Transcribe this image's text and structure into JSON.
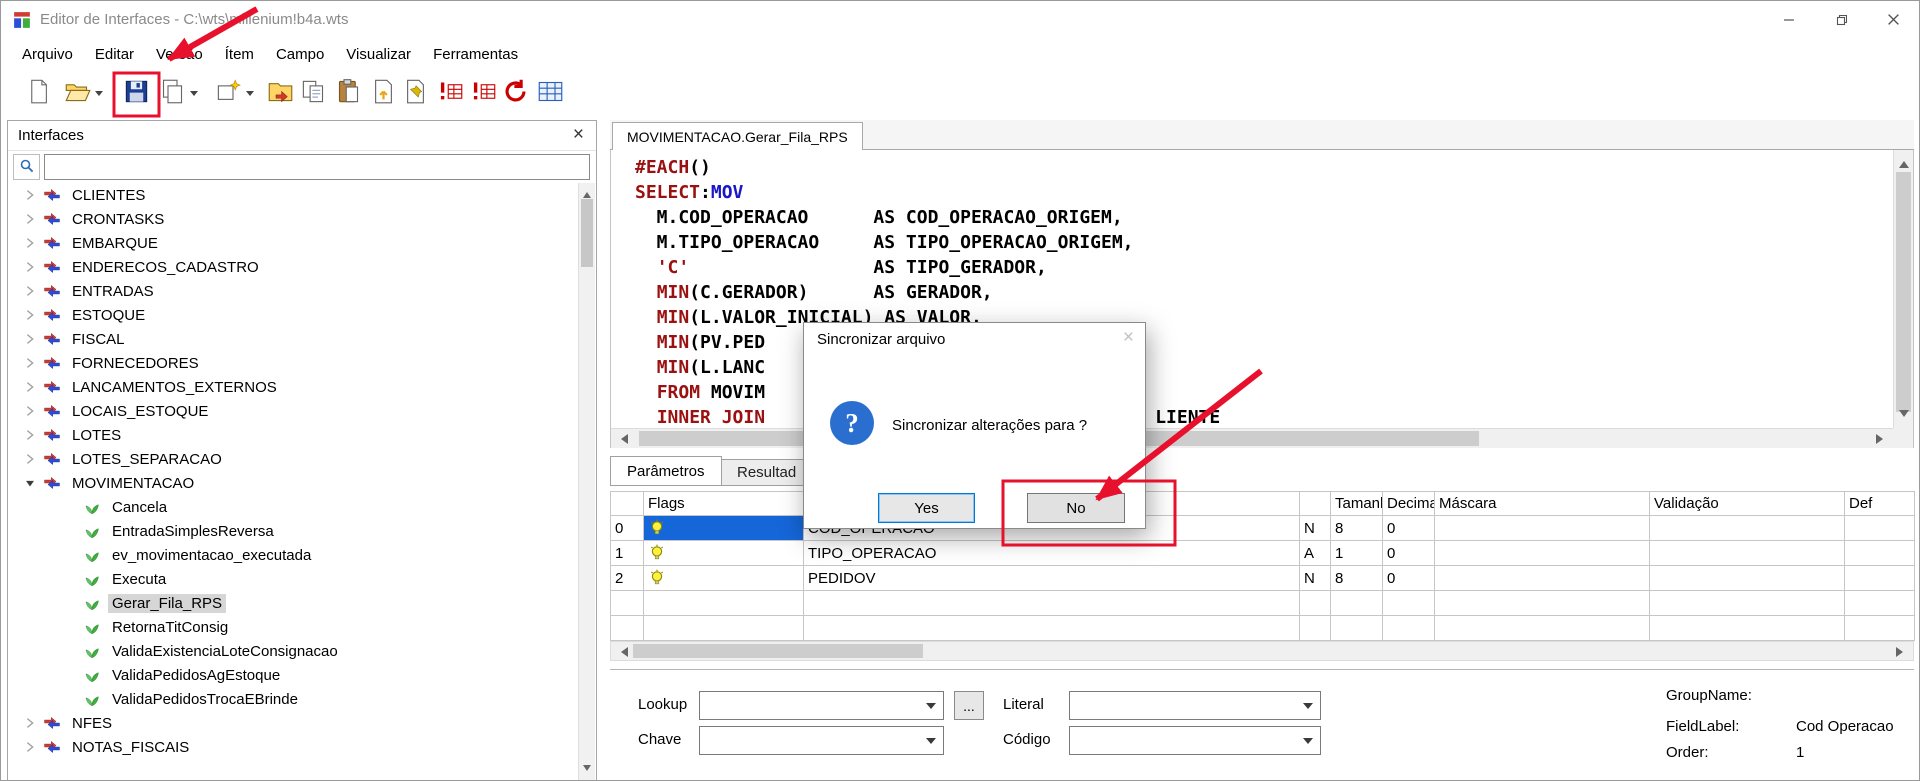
{
  "window": {
    "title": "Editor de Interfaces - C:\\wts\\millenium!b4a.wts"
  },
  "menu_items": [
    "Arquivo",
    "Editar",
    "Versão",
    "Ítem",
    "Campo",
    "Visualizar",
    "Ferramentas"
  ],
  "toolbar": [
    {
      "name": "new-file-icon"
    },
    {
      "name": "open-icon",
      "dropdown": true
    },
    {
      "name": "save-icon",
      "highlighted": true
    },
    {
      "name": "save-all-icon",
      "dropdown": true
    },
    {
      "name": "new-interface-icon",
      "dropdown": true
    },
    {
      "name": "export-folder-icon"
    },
    {
      "name": "copy-icon"
    },
    {
      "name": "paste-icon"
    },
    {
      "name": "import-file-icon"
    },
    {
      "name": "pin-file-icon"
    },
    {
      "name": "check-fields-icon"
    },
    {
      "name": "check-fields-2-icon"
    },
    {
      "name": "refresh-icon"
    },
    {
      "name": "data-grid-icon"
    }
  ],
  "sidebar": {
    "title": "Interfaces",
    "search_value": "",
    "tree": [
      {
        "label": "CLIENTES",
        "level": 0
      },
      {
        "label": "CRONTASKS",
        "level": 0
      },
      {
        "label": "EMBARQUE",
        "level": 0
      },
      {
        "label": "ENDERECOS_CADASTRO",
        "level": 0
      },
      {
        "label": "ENTRADAS",
        "level": 0
      },
      {
        "label": "ESTOQUE",
        "level": 0
      },
      {
        "label": "FISCAL",
        "level": 0
      },
      {
        "label": "FORNECEDORES",
        "level": 0
      },
      {
        "label": "LANCAMENTOS_EXTERNOS",
        "level": 0
      },
      {
        "label": "LOCAIS_ESTOQUE",
        "level": 0
      },
      {
        "label": "LOTES",
        "level": 0
      },
      {
        "label": "LOTES_SEPARACAO",
        "level": 0
      },
      {
        "label": "MOVIMENTACAO",
        "level": 0,
        "expanded": true
      },
      {
        "label": "Cancela",
        "level": 1
      },
      {
        "label": "EntradaSimplesReversa",
        "level": 1
      },
      {
        "label": "ev_movimentacao_executada",
        "level": 1
      },
      {
        "label": "Executa",
        "level": 1
      },
      {
        "label": "Gerar_Fila_RPS",
        "level": 1,
        "selected": true
      },
      {
        "label": "RetornaTitConsig",
        "level": 1
      },
      {
        "label": "ValidaExistenciaLoteConsignacao",
        "level": 1
      },
      {
        "label": "ValidaPedidosAgEstoque",
        "level": 1
      },
      {
        "label": "ValidaPedidosTrocaEBrinde",
        "level": 1
      },
      {
        "label": "NFES",
        "level": 0
      },
      {
        "label": "NOTAS_FISCAIS",
        "level": 0
      }
    ]
  },
  "editor": {
    "tab": "MOVIMENTACAO.Gerar_Fila_RPS",
    "code": [
      [
        {
          "t": "#EACH",
          "c": "kw"
        },
        {
          "t": "()",
          "c": "pl"
        }
      ],
      [
        {
          "t": "SELECT",
          "c": "kw"
        },
        {
          "t": ":",
          "c": "pl"
        },
        {
          "t": "MOV",
          "c": "tbl"
        }
      ],
      [
        {
          "t": "  M.COD_OPERACAO      AS COD_OPERACAO_ORIGEM,",
          "c": "pl"
        }
      ],
      [
        {
          "t": "  M.TIPO_OPERACAO     AS TIPO_OPERACAO_ORIGEM,",
          "c": "pl"
        }
      ],
      [
        {
          "t": "  ",
          "c": "pl"
        },
        {
          "t": "'C'",
          "c": "str"
        },
        {
          "t": "                 AS TIPO_GERADOR,",
          "c": "pl"
        }
      ],
      [
        {
          "t": "  ",
          "c": "pl"
        },
        {
          "t": "MIN",
          "c": "kw"
        },
        {
          "t": "(C.GERADOR)      AS GERADOR,",
          "c": "pl"
        }
      ],
      [
        {
          "t": "  ",
          "c": "pl"
        },
        {
          "t": "MIN",
          "c": "kw"
        },
        {
          "t": "(L.VALOR_INICIAL) AS VALOR,",
          "c": "pl"
        }
      ],
      [
        {
          "t": "  ",
          "c": "pl"
        },
        {
          "t": "MIN",
          "c": "kw"
        },
        {
          "t": "(PV.PED",
          "c": "pl"
        }
      ],
      [
        {
          "t": "  ",
          "c": "pl"
        },
        {
          "t": "MIN",
          "c": "kw"
        },
        {
          "t": "(L.LANC",
          "c": "pl"
        }
      ],
      [
        {
          "t": "  ",
          "c": "pl"
        },
        {
          "t": "FROM",
          "c": "kw"
        },
        {
          "t": " MOVIM",
          "c": "pl"
        }
      ],
      [
        {
          "t": "  ",
          "c": "pl"
        },
        {
          "t": "INNER JOIN",
          "c": "kw"
        },
        {
          "t": "LIENTE",
          "c": "pl",
          "sp": 36
        }
      ]
    ]
  },
  "params": {
    "tabs": [
      {
        "label": "Parâmetros",
        "active": true
      },
      {
        "label": "Resultad",
        "active": false
      }
    ],
    "columns": [
      "",
      "Flags",
      "",
      "",
      "Tamanh",
      "Decima",
      "Máscara",
      "Validação",
      "Def"
    ],
    "rows": [
      {
        "n": "0",
        "flag": "lightbulb",
        "nome": "COD_OPERACAO",
        "tipo": "N",
        "tam": "8",
        "dec": "0",
        "masc": "",
        "val": "",
        "def": "",
        "selected": true
      },
      {
        "n": "1",
        "flag": "lightbulb",
        "nome": "TIPO_OPERACAO",
        "tipo": "A",
        "tam": "1",
        "dec": "0",
        "masc": "",
        "val": "",
        "def": ""
      },
      {
        "n": "2",
        "flag": "lightbulb",
        "nome": "PEDIDOV",
        "tipo": "N",
        "tam": "8",
        "dec": "0",
        "masc": "",
        "val": "",
        "def": ""
      },
      {
        "n": "",
        "flag": "",
        "nome": "",
        "tipo": "",
        "tam": "",
        "dec": "",
        "masc": "",
        "val": "",
        "def": ""
      },
      {
        "n": "",
        "flag": "",
        "nome": "",
        "tipo": "",
        "tam": "",
        "dec": "",
        "masc": "",
        "val": "",
        "def": ""
      }
    ]
  },
  "footer": {
    "lookup_label": "Lookup",
    "lookup_value": "",
    "more_button": "...",
    "literal_label": "Literal",
    "literal_value": "",
    "chave_label": "Chave",
    "chave_value": "",
    "codigo_label": "Código",
    "codigo_value": "",
    "groupname_label": "GroupName:",
    "groupname_value": "",
    "fieldlabel_label": "FieldLabel:",
    "fieldlabel_value": "Cod Operacao",
    "order_label": "Order:",
    "order_value": "1"
  },
  "dialog": {
    "title": "Sincronizar arquivo",
    "message": "Sincronizar alterações para ?",
    "buttons": [
      {
        "label": "Yes",
        "default": true
      },
      {
        "label": "No"
      }
    ]
  },
  "icons": {
    "search": "magnifier",
    "flags": "lightbulb",
    "dialog": "question-mark-circle",
    "tree_group": "red-blue-interface-arrows",
    "tree_leaf": "green-sprout"
  },
  "colors": {
    "annotation": "#e8112d",
    "selection": "#1566d8",
    "keyword": "#9a1111",
    "table_ref": "#1a16c8",
    "default_button_border": "#0078d7"
  }
}
